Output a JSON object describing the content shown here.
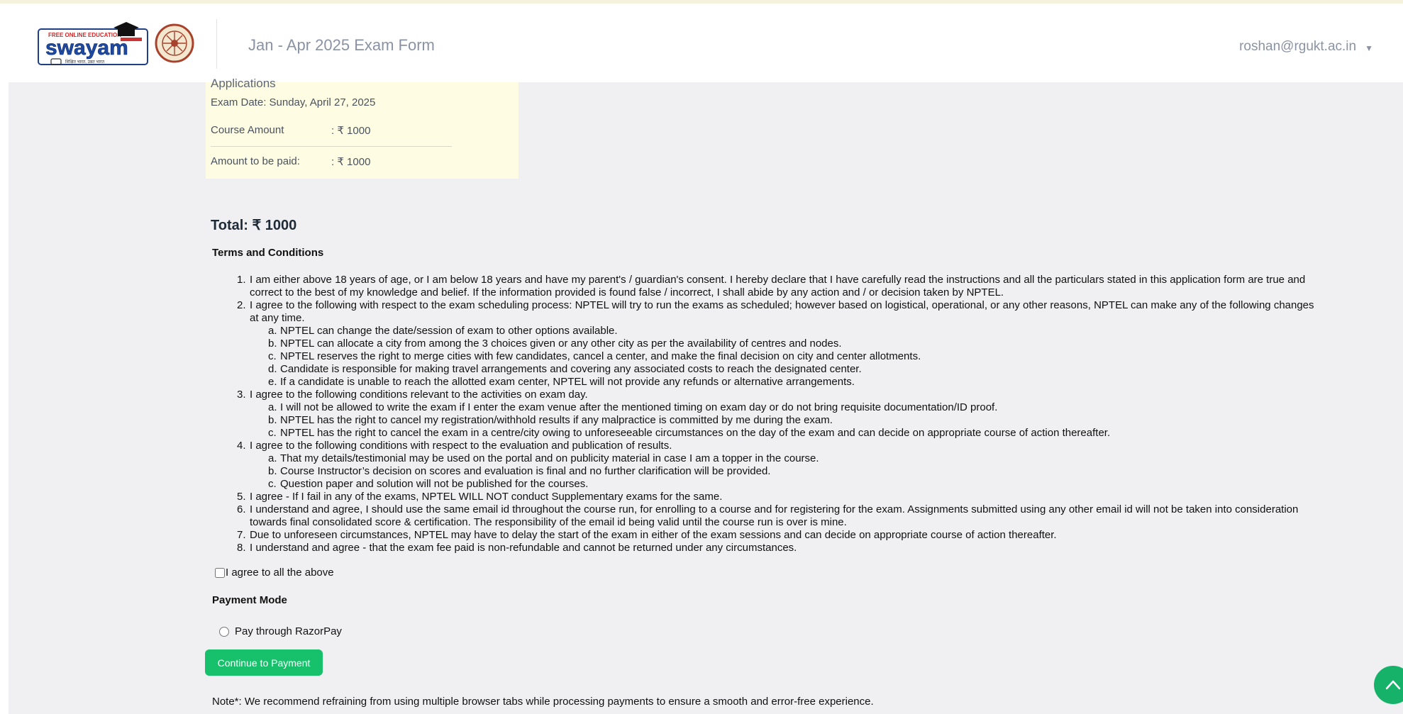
{
  "header": {
    "logo_alt": "swayam",
    "title": "Jan - Apr 2025 Exam Form",
    "user_email": "roshan@rgukt.ac.in",
    "user_caret_icon": "caret-down-icon"
  },
  "course": {
    "name_partial": "Applications",
    "exam_date": "Exam Date: Sunday, April 27, 2025",
    "course_amount_label": "Course Amount",
    "course_amount_value": ": ₹ 1000",
    "to_pay_label": "Amount to be paid:",
    "to_pay_value": ": ₹ 1000"
  },
  "total": "Total: ₹ 1000",
  "terms": {
    "heading": "Terms and Conditions",
    "items": [
      {
        "num": "1.",
        "lines": [
          "I am either above 18 years of age, or I am below 18 years and have my parent's / guardian's consent. I hereby declare that I have carefully read the instructions and all the particulars stated in this application form are true and",
          "correct to the best of my knowledge and belief. If the information provided is found false / incorrect, I shall abide by any action and / or decision taken by NPTEL."
        ]
      },
      {
        "num": "2.",
        "lines": [
          "I agree to the following with respect to the exam scheduling process: NPTEL will try to run the exams as scheduled; however based on logistical, operational, or any other reasons, NPTEL can make any of the following changes",
          "at any time."
        ],
        "subs": [
          {
            "l": "a.",
            "text": "NPTEL can change the date/session of exam to other options available."
          },
          {
            "l": "b.",
            "text": "NPTEL can allocate a city from among the 3 choices given or any other city as per the availability of centres and nodes."
          },
          {
            "l": "c.",
            "text": "NPTEL reserves the right to merge cities with few candidates, cancel a center, and make the final decision on city and center allotments."
          },
          {
            "l": "d.",
            "text": "Candidate is responsible for making travel arrangements and covering any associated costs to reach the designated center."
          },
          {
            "l": "e.",
            "text": "If a candidate is unable to reach the allotted exam center, NPTEL will not provide any refunds or alternative arrangements."
          }
        ]
      },
      {
        "num": "3.",
        "lines": [
          "I agree to the following conditions relevant to the activities on exam day."
        ],
        "subs": [
          {
            "l": "a.",
            "text": "I will not be allowed to write the exam if I enter the exam venue after the mentioned timing on exam day or do not bring requisite documentation/ID proof."
          },
          {
            "l": "b.",
            "text": "NPTEL has the right to cancel my registration/withhold results if any malpractice is committed by me during the exam."
          },
          {
            "l": "c.",
            "text": "NPTEL has the right to cancel the exam in a centre/city owing to unforeseeable circumstances on the day of the exam and can decide on appropriate course of action thereafter."
          }
        ]
      },
      {
        "num": "4.",
        "lines": [
          "I agree to the following conditions with respect to the evaluation and publication of results."
        ],
        "subs": [
          {
            "l": "a.",
            "text": "That my details/testimonial may be used on the portal and on publicity material in case I am a topper in the course."
          },
          {
            "l": "b.",
            "text": "Course Instructor’s decision on scores and evaluation is final and no further clarification will be provided."
          },
          {
            "l": "c.",
            "text": "Question paper and solution will not be published for the courses."
          }
        ]
      },
      {
        "num": "5.",
        "lines": [
          "I agree - If I fail in any of the exams, NPTEL WILL NOT conduct Supplementary exams for the same."
        ]
      },
      {
        "num": "6.",
        "lines": [
          "I understand and agree, I should use the same email id throughout the course run, for enrolling to a course and for registering for the exam. Assignments submitted using any other email id will not be taken into consideration",
          "towards final consolidated score & certification. The responsibility of the email id being valid until the course run is over is mine."
        ]
      },
      {
        "num": "7.",
        "lines": [
          "Due to unforeseen circumstances, NPTEL may have to delay the start of the exam in either of the exam sessions and can decide on appropriate course of action thereafter."
        ]
      },
      {
        "num": "8.",
        "lines": [
          "I understand and agree - that the exam fee paid is non-refundable and cannot be returned under any circumstances."
        ]
      }
    ]
  },
  "agree_label": "I agree to all the above",
  "payment": {
    "heading": "Payment Mode",
    "option_label": "Pay through RazorPay",
    "button_label": "Continue to Payment"
  },
  "note": "Note*: We recommend refraining from using multiple browser tabs while processing payments to ensure a smooth and error-free experience.",
  "colors": {
    "accent_green": "#17c06a",
    "summary_bg": "#fefde3",
    "page_bg": "#f0f0f2"
  }
}
